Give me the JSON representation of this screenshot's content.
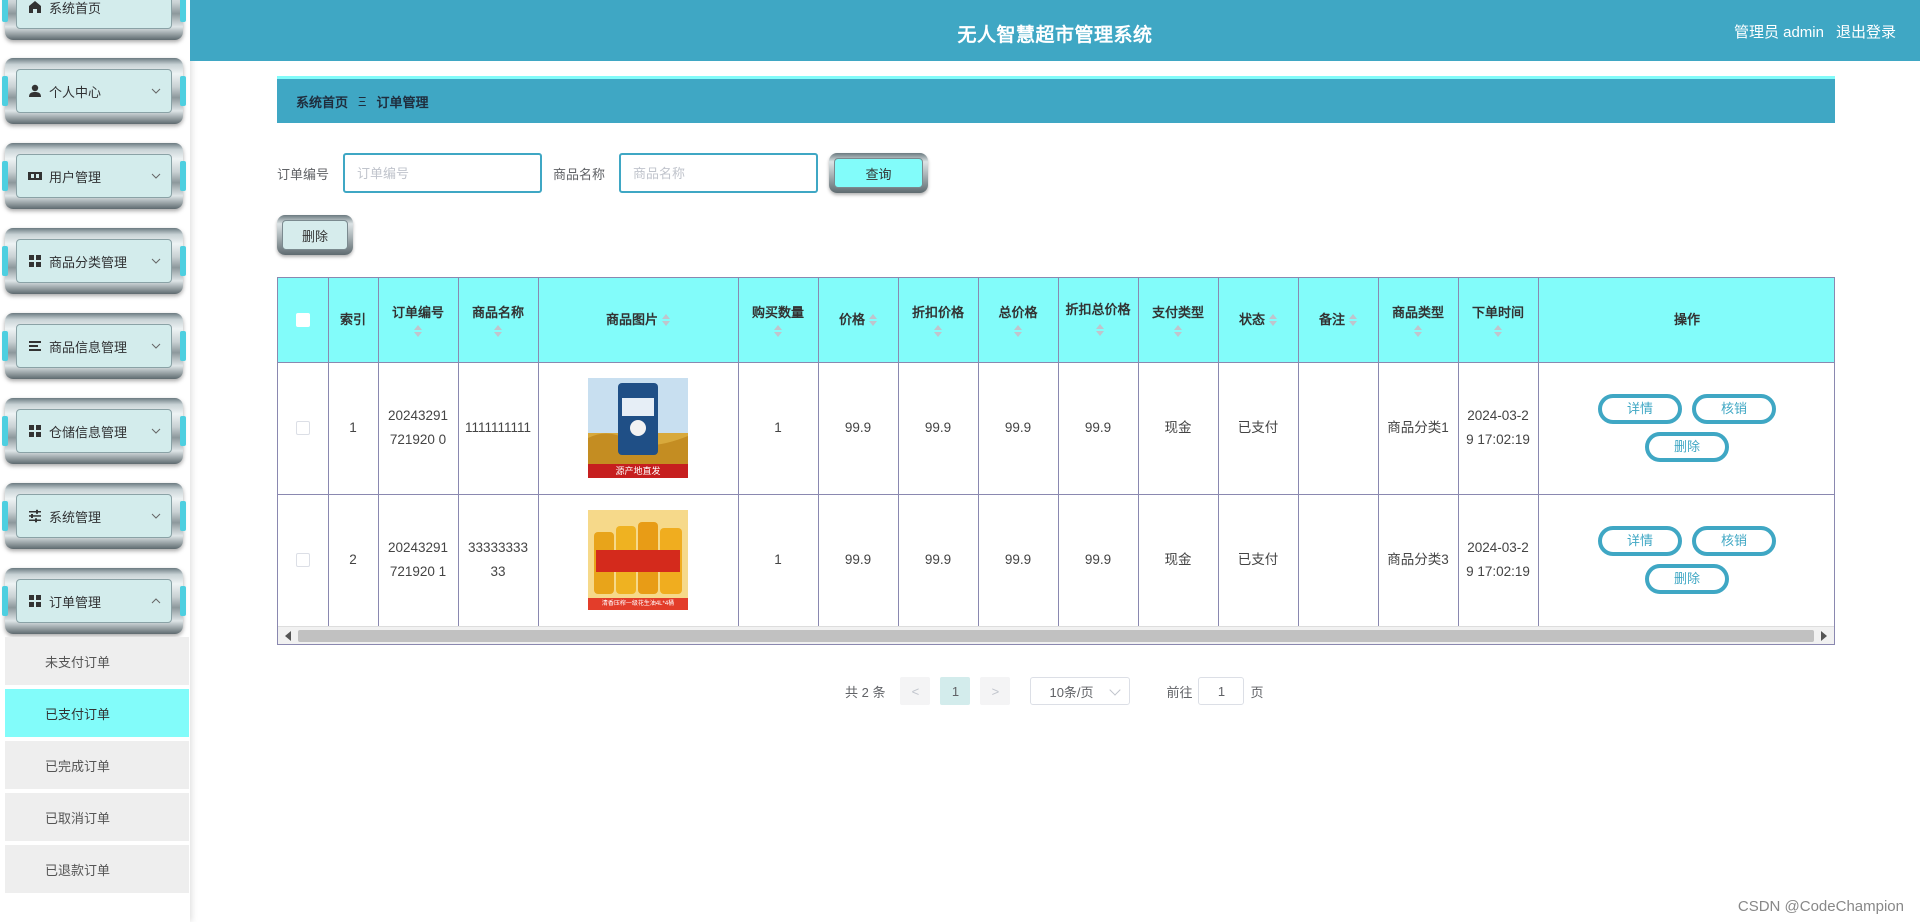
{
  "header": {
    "app_title": "无人智慧超市管理系统",
    "user_label": "管理员 admin",
    "logout_label": "退出登录"
  },
  "sidebar": {
    "items": [
      {
        "label": "系统首页",
        "icon": "home-icon"
      },
      {
        "label": "个人中心",
        "icon": "user-icon"
      },
      {
        "label": "用户管理",
        "icon": "users-icon"
      },
      {
        "label": "商品分类管理",
        "icon": "grid-icon"
      },
      {
        "label": "商品信息管理",
        "icon": "list-icon"
      },
      {
        "label": "仓储信息管理",
        "icon": "grid-icon"
      },
      {
        "label": "系统管理",
        "icon": "sliders-icon"
      },
      {
        "label": "订单管理",
        "icon": "grid-icon"
      }
    ],
    "submenu": [
      {
        "label": "未支付订单"
      },
      {
        "label": "已支付订单",
        "active": true
      },
      {
        "label": "已完成订单"
      },
      {
        "label": "已取消订单"
      },
      {
        "label": "已退款订单"
      }
    ]
  },
  "breadcrumb": {
    "home": "系统首页",
    "separator": "Ξ",
    "current": "订单管理"
  },
  "search": {
    "order_no_label": "订单编号",
    "order_no_placeholder": "订单编号",
    "order_no_value": "",
    "product_name_label": "商品名称",
    "product_name_placeholder": "商品名称",
    "product_name_value": "",
    "query_label": "查询"
  },
  "toolbar": {
    "delete_label": "删除"
  },
  "table": {
    "columns": [
      "",
      "索引",
      "订单编号",
      "商品名称",
      "商品图片",
      "购买数量",
      "价格",
      "折扣价格",
      "总价格",
      "折扣总价格",
      "支付类型",
      "状态",
      "备注",
      "商品类型",
      "下单时间",
      "操作"
    ],
    "rows": [
      {
        "index": "1",
        "order_no": "20243291721920 0",
        "product_name": "1111111111",
        "image": "rice-bag",
        "quantity": "1",
        "price": "99.9",
        "discount_price": "99.9",
        "total_price": "99.9",
        "discount_total": "99.9",
        "pay_type": "现金",
        "status": "已支付",
        "remark": "",
        "category": "商品分类1",
        "order_time": "2024-03-29 17:02:19"
      },
      {
        "index": "2",
        "order_no": "20243291721920 1",
        "product_name": "3333333333",
        "image": "oil-bottles",
        "quantity": "1",
        "price": "99.9",
        "discount_price": "99.9",
        "total_price": "99.9",
        "discount_total": "99.9",
        "pay_type": "现金",
        "status": "已支付",
        "remark": "",
        "category": "商品分类3",
        "order_time": "2024-03-29 17:02:19"
      }
    ],
    "actions": {
      "detail": "详情",
      "verify": "核销",
      "delete": "删除"
    },
    "images": {
      "rice_caption": "源产地直发",
      "oil_caption": "清香压榨一级花生油4L*4桶"
    }
  },
  "pagination": {
    "total_text": "共 2 条",
    "current_page": "1",
    "prev": "<",
    "next": ">",
    "page_size": "10条/页",
    "goto_prefix": "前往",
    "goto_value": "1",
    "goto_suffix": "页"
  },
  "watermark": "CSDN @CodeChampion",
  "colors": {
    "primary": "#3fa7c4",
    "accent": "#82fcfa",
    "submenu_bg": "#eeeeee"
  }
}
